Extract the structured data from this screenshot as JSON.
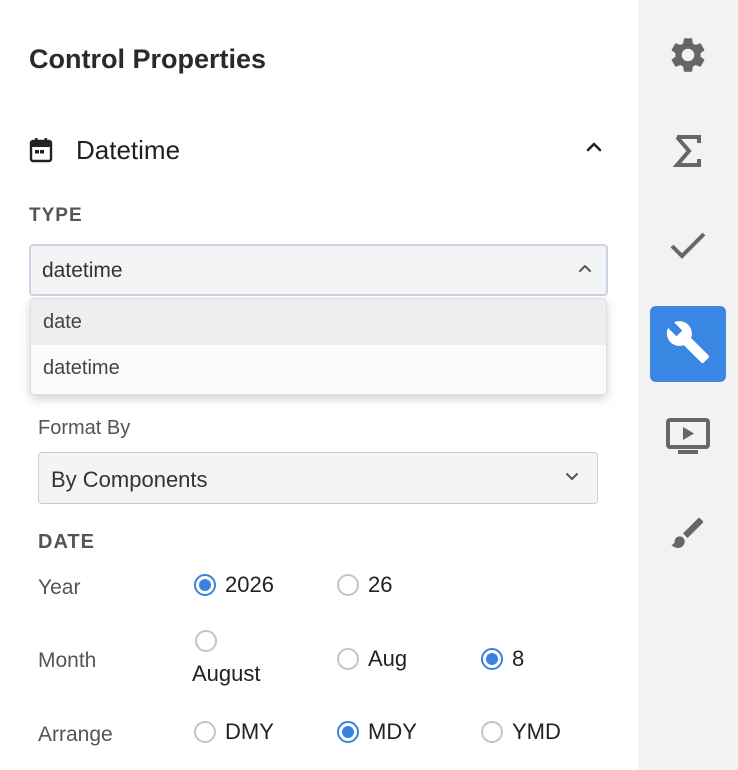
{
  "panel": {
    "title": "Control Properties"
  },
  "section": {
    "title": "Datetime",
    "icon": "calendar-icon",
    "expanded": true
  },
  "type": {
    "label": "TYPE",
    "value": "datetime",
    "options": [
      {
        "label": "date",
        "highlighted": true
      },
      {
        "label": "datetime",
        "highlighted": false
      }
    ]
  },
  "format": {
    "label": "Format By",
    "value": "By Components"
  },
  "date": {
    "label": "DATE",
    "year": {
      "label": "Year",
      "options": [
        {
          "label": "2026",
          "selected": true
        },
        {
          "label": "26",
          "selected": false
        }
      ]
    },
    "month": {
      "label": "Month",
      "options": [
        {
          "label": "August",
          "selected": false
        },
        {
          "label": "Aug",
          "selected": false
        },
        {
          "label": "8",
          "selected": true
        }
      ]
    },
    "arrange": {
      "label": "Arrange",
      "options": [
        {
          "label": "DMY",
          "selected": false
        },
        {
          "label": "MDY",
          "selected": true
        },
        {
          "label": "YMD",
          "selected": false
        }
      ]
    }
  },
  "rail": {
    "items": [
      {
        "name": "gear-icon",
        "active": false
      },
      {
        "name": "sigma-icon",
        "active": false
      },
      {
        "name": "checkmark-icon",
        "active": false
      },
      {
        "name": "wrench-icon",
        "active": true
      },
      {
        "name": "monitor-play-icon",
        "active": false
      },
      {
        "name": "brush-icon",
        "active": false
      }
    ]
  },
  "colors": {
    "accent": "#3a86e3",
    "rail_bg": "#f2f2f2",
    "icon": "#666666"
  }
}
